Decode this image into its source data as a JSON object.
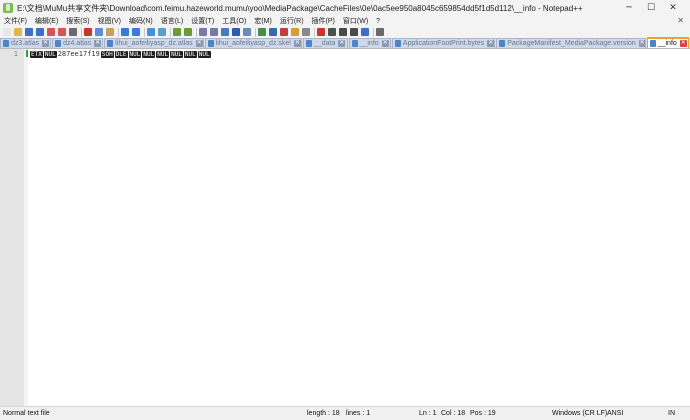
{
  "window": {
    "title": "E:\\文档\\MuMu共享文件夹\\Download\\com.feimu.hazeworld.mumu\\yoo\\MediaPackage\\CacheFiles\\0e\\0ac5ee950a8045c659854dd5f1d5d112\\__info - Notepad++",
    "minimize": "─",
    "maximize": "☐",
    "close": "✕"
  },
  "menu": {
    "items": [
      "文件(F)",
      "编辑(E)",
      "搜索(S)",
      "视图(V)",
      "编码(N)",
      "语言(L)",
      "设置(T)",
      "工具(O)",
      "宏(M)",
      "运行(R)",
      "插件(P)",
      "窗口(W)",
      "?"
    ],
    "right_glyph": "✕"
  },
  "toolbar": {
    "icons": [
      {
        "name": "new-file-icon",
        "color": "#e8e8e8"
      },
      {
        "name": "open-file-icon",
        "color": "#e2b64a"
      },
      {
        "name": "save-icon",
        "color": "#3d6fc2"
      },
      {
        "name": "save-all-icon",
        "color": "#3d6fc2"
      },
      {
        "name": "close-icon",
        "color": "#d9534f"
      },
      {
        "name": "close-all-icon",
        "color": "#d9534f"
      },
      {
        "name": "print-icon",
        "color": "#6b6b6b"
      },
      {
        "sep": true
      },
      {
        "name": "cut-icon",
        "color": "#c0392b"
      },
      {
        "name": "copy-icon",
        "color": "#5a8fd6"
      },
      {
        "name": "paste-icon",
        "color": "#c8a060"
      },
      {
        "sep": true
      },
      {
        "name": "undo-icon",
        "color": "#3a7bd5"
      },
      {
        "name": "redo-icon",
        "color": "#3a7bd5"
      },
      {
        "sep": true
      },
      {
        "name": "find-icon",
        "color": "#4a90d9"
      },
      {
        "name": "replace-icon",
        "color": "#5aa0c8"
      },
      {
        "sep": true
      },
      {
        "name": "zoom-in-icon",
        "color": "#6a9a3a"
      },
      {
        "name": "zoom-out-icon",
        "color": "#6a9a3a"
      },
      {
        "sep": true
      },
      {
        "name": "sync-vertical-icon",
        "color": "#7a7aa8"
      },
      {
        "name": "sync-horizontal-icon",
        "color": "#7a7aa8"
      },
      {
        "name": "word-wrap-icon",
        "color": "#4a7ab8"
      },
      {
        "name": "show-all-chars-icon",
        "color": "#2c5ea8"
      },
      {
        "name": "indent-guide-icon",
        "color": "#6a8ab8"
      },
      {
        "sep": true
      },
      {
        "name": "udl-icon",
        "color": "#4a8a4a"
      },
      {
        "name": "doc-map-icon",
        "color": "#3a6aa8"
      },
      {
        "name": "function-list-icon",
        "color": "#c04040"
      },
      {
        "name": "folder-workspace-icon",
        "color": "#d4a030"
      },
      {
        "name": "monitoring-icon",
        "color": "#8a8a8a"
      },
      {
        "sep": true
      },
      {
        "name": "record-macro-icon",
        "color": "#d03030"
      },
      {
        "name": "stop-record-icon",
        "color": "#505050"
      },
      {
        "name": "playback-macro-icon",
        "color": "#4a4a4a"
      },
      {
        "name": "run-macro-multiple-icon",
        "color": "#4a4a4a"
      },
      {
        "name": "save-macro-icon",
        "color": "#3d6fc2"
      },
      {
        "sep": true
      },
      {
        "name": "spell-check-icon",
        "color": "#6a6a6a"
      }
    ]
  },
  "tabs": [
    {
      "label": "dz3.atlas",
      "active": false
    },
    {
      "label": "dz4.atlas",
      "active": false
    },
    {
      "label": "lihui_aofeiliyasp_dz.atlas",
      "active": false
    },
    {
      "label": "lihui_aofeiliyasp_dz.skel",
      "active": false
    },
    {
      "label": "__data",
      "active": false
    },
    {
      "label": "__info",
      "active": false
    },
    {
      "label": "ApplicationFootPrint.bytes",
      "active": false
    },
    {
      "label": "PackageManifest_MediaPackage.version",
      "active": false
    },
    {
      "label": "__info",
      "active": true
    }
  ],
  "editor": {
    "line_number": "1",
    "segments": [
      {
        "type": "ctrl",
        "text": "ETX"
      },
      {
        "type": "ctrl",
        "text": "NUL"
      },
      {
        "type": "plain",
        "text": "287ee17f19"
      },
      {
        "type": "ctrl",
        "text": "SOH"
      },
      {
        "type": "ctrl",
        "text": "DLE"
      },
      {
        "type": "ctrl",
        "text": "NUL"
      },
      {
        "type": "ctrl",
        "text": "NUL"
      },
      {
        "type": "ctrl",
        "text": "NUL"
      },
      {
        "type": "ctrl",
        "text": "NUL"
      },
      {
        "type": "ctrl",
        "text": "NUL"
      },
      {
        "type": "ctrl",
        "text": "NUL"
      }
    ]
  },
  "status": {
    "file_type": "Normal text file",
    "length": "length : 18",
    "lines": "lines : 1",
    "ln": "Ln : 1",
    "col": "Col : 18",
    "pos": "Pos : 19",
    "eol": "Windows (CR LF)",
    "encoding": "ANSI",
    "mode": "IN"
  }
}
